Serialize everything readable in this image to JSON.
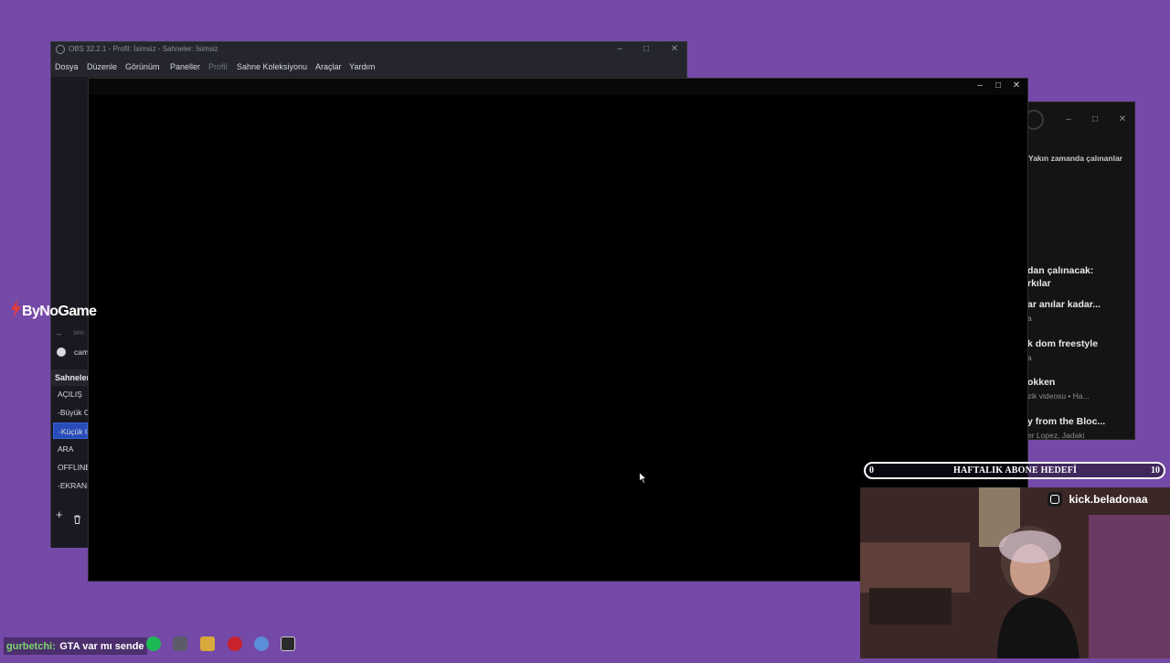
{
  "obs": {
    "title": "OBS 32.2.1 - Profil: İsimsiz - Sahneler: İsimsiz",
    "menu": [
      "Dosya",
      "Düzenle",
      "Görünüm",
      "Paneller",
      "Profil",
      "Sahne Koleksiyonu",
      "Araçlar",
      "Yardım"
    ],
    "zoom": "36%",
    "source_label": "cam",
    "scenes_header": "Sahneler",
    "scenes": [
      "AÇILIŞ",
      "-Büyük C",
      "-Küçük C",
      "ARA",
      "OFFLINE",
      "-EKRAN-"
    ],
    "selected_scene_index": 2
  },
  "right_panel": {
    "recent_label": "Yakın zamanda çalınanlar",
    "next_label_line1": "dan çalınacak:",
    "next_label_line2": "rkılar",
    "tracks": [
      {
        "title": "ar anılar kadar...",
        "sub": "a"
      },
      {
        "title": "k dom freestyle",
        "sub": "a"
      },
      {
        "title": "okken",
        "sub": "zik videosu • Ha..."
      },
      {
        "title": "y from the Bloc...",
        "sub": "er Lopez, Jadaki"
      }
    ]
  },
  "overlay": {
    "sponsor": "ByNoGame",
    "goal_left": "0",
    "goal_title": "HAFTALIK ABONE HEDEFİ",
    "goal_right": "10",
    "instagram": "kick.beladonaa",
    "chat_user": "gurbetchi:",
    "chat_message": "GTA var mı sende"
  },
  "taskbar_icons": [
    "app-icon",
    "spotify-icon",
    "app-icon-2",
    "folder-icon",
    "pinterest-icon",
    "settings-icon",
    "epic-games-icon"
  ],
  "colors": {
    "background": "#7549a8",
    "selected_scene": "#284cb8",
    "spotify": "#1db954"
  }
}
